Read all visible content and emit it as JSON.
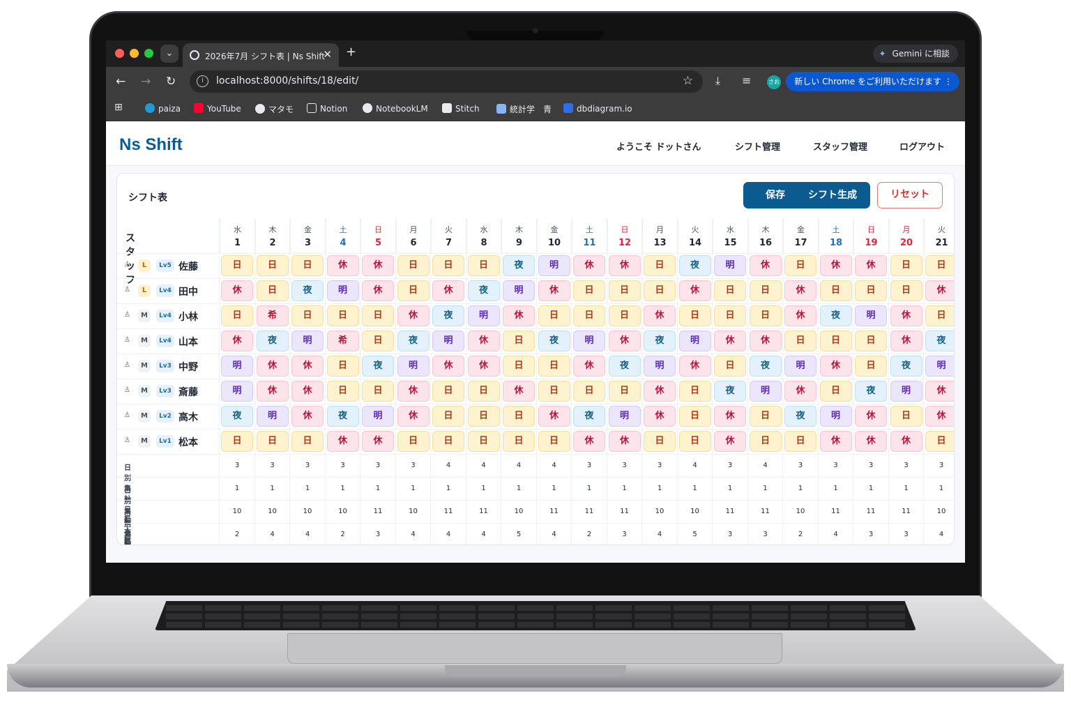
{
  "browser": {
    "tab_title": "2026年7月 シフト表 | Ns Shift",
    "url": "localhost:8000/shifts/18/edit/",
    "gemini_label": "Gemini に相談",
    "update_label": "新しい Chrome をご利用いただけます",
    "profile_initials": "さお",
    "bookmarks": [
      "paiza",
      "YouTube",
      "マタモ",
      "Notion",
      "NotebookLM",
      "Stitch",
      "統計学　青",
      "dbdiagram.io"
    ]
  },
  "app": {
    "logo": "Ns Shift",
    "nav": {
      "welcome": "ようこそ ドットさん",
      "shift_mgmt": "シフト管理",
      "staff_mgmt": "スタッフ管理",
      "logout": "ログアウト"
    }
  },
  "card": {
    "title": "シフト表",
    "buttons": {
      "save": "保存",
      "generate": "シフト生成",
      "reset": "リセット"
    },
    "staff_header": "スタッフ"
  },
  "days": [
    {
      "wd": "水",
      "d": "1",
      "t": ""
    },
    {
      "wd": "木",
      "d": "2",
      "t": ""
    },
    {
      "wd": "金",
      "d": "3",
      "t": ""
    },
    {
      "wd": "土",
      "d": "4",
      "t": "sat"
    },
    {
      "wd": "日",
      "d": "5",
      "t": "sun"
    },
    {
      "wd": "月",
      "d": "6",
      "t": ""
    },
    {
      "wd": "火",
      "d": "7",
      "t": ""
    },
    {
      "wd": "水",
      "d": "8",
      "t": ""
    },
    {
      "wd": "木",
      "d": "9",
      "t": ""
    },
    {
      "wd": "金",
      "d": "10",
      "t": ""
    },
    {
      "wd": "土",
      "d": "11",
      "t": "sat"
    },
    {
      "wd": "日",
      "d": "12",
      "t": "sun"
    },
    {
      "wd": "月",
      "d": "13",
      "t": ""
    },
    {
      "wd": "火",
      "d": "14",
      "t": ""
    },
    {
      "wd": "水",
      "d": "15",
      "t": ""
    },
    {
      "wd": "木",
      "d": "16",
      "t": ""
    },
    {
      "wd": "金",
      "d": "17",
      "t": ""
    },
    {
      "wd": "土",
      "d": "18",
      "t": "sat"
    },
    {
      "wd": "日",
      "d": "19",
      "t": "sun"
    },
    {
      "wd": "月",
      "d": "20",
      "t": "sun"
    },
    {
      "wd": "火",
      "d": "21",
      "t": ""
    }
  ],
  "staff": [
    {
      "role": "♙",
      "lead": "L",
      "lv": "Lv5",
      "name": "佐藤",
      "shifts": [
        "日",
        "日",
        "日",
        "休",
        "休",
        "日",
        "日",
        "日",
        "夜",
        "明",
        "休",
        "休",
        "日",
        "夜",
        "明",
        "休",
        "日",
        "休",
        "休",
        "日",
        "日"
      ]
    },
    {
      "role": "♙",
      "lead": "L",
      "lv": "Lv4",
      "name": "田中",
      "shifts": [
        "休",
        "日",
        "夜",
        "明",
        "休",
        "日",
        "休",
        "夜",
        "明",
        "休",
        "日",
        "日",
        "日",
        "休",
        "日",
        "日",
        "休",
        "日",
        "日",
        "日",
        "休"
      ]
    },
    {
      "role": "♙",
      "lead": "M",
      "lv": "Lv4",
      "name": "小林",
      "shifts": [
        "日",
        "希",
        "日",
        "日",
        "日",
        "休",
        "夜",
        "明",
        "休",
        "日",
        "日",
        "日",
        "休",
        "日",
        "日",
        "日",
        "休",
        "夜",
        "明",
        "休",
        "日"
      ]
    },
    {
      "role": "♙",
      "lead": "M",
      "lv": "Lv4",
      "name": "山本",
      "shifts": [
        "休",
        "夜",
        "明",
        "希",
        "日",
        "夜",
        "明",
        "休",
        "日",
        "夜",
        "明",
        "休",
        "夜",
        "明",
        "休",
        "休",
        "日",
        "日",
        "日",
        "休",
        "夜"
      ]
    },
    {
      "role": "♙",
      "lead": "M",
      "lv": "Lv3",
      "name": "中野",
      "shifts": [
        "明",
        "休",
        "休",
        "日",
        "夜",
        "明",
        "休",
        "休",
        "日",
        "日",
        "休",
        "夜",
        "明",
        "休",
        "日",
        "夜",
        "明",
        "休",
        "日",
        "夜",
        "明"
      ]
    },
    {
      "role": "♙",
      "lead": "M",
      "lv": "Lv3",
      "name": "斎藤",
      "shifts": [
        "明",
        "休",
        "休",
        "日",
        "日",
        "休",
        "日",
        "日",
        "休",
        "日",
        "日",
        "日",
        "休",
        "日",
        "夜",
        "明",
        "休",
        "日",
        "夜",
        "明",
        "休"
      ]
    },
    {
      "role": "♙",
      "lead": "M",
      "lv": "Lv2",
      "name": "高木",
      "shifts": [
        "夜",
        "明",
        "休",
        "夜",
        "明",
        "休",
        "日",
        "日",
        "日",
        "休",
        "夜",
        "明",
        "休",
        "日",
        "休",
        "日",
        "夜",
        "明",
        "休",
        "日",
        "休"
      ]
    },
    {
      "role": "♙",
      "lead": "M",
      "lv": "Lv1",
      "name": "松本",
      "shifts": [
        "日",
        "日",
        "日",
        "休",
        "休",
        "日",
        "日",
        "日",
        "日",
        "日",
        "休",
        "休",
        "日",
        "日",
        "休",
        "日",
        "日",
        "休",
        "休",
        "休",
        "日"
      ]
    }
  ],
  "summary": [
    {
      "label": "日別集計 日勤人数",
      "values": [
        "3",
        "3",
        "3",
        "3",
        "3",
        "3",
        "4",
        "4",
        "4",
        "4",
        "3",
        "3",
        "3",
        "4",
        "3",
        "4",
        "3",
        "3",
        "3",
        "3",
        "3"
      ]
    },
    {
      "label": "日別集計 夜勤人数",
      "values": [
        "1",
        "1",
        "1",
        "1",
        "1",
        "1",
        "1",
        "1",
        "1",
        "1",
        "1",
        "1",
        "1",
        "1",
        "1",
        "1",
        "1",
        "1",
        "1",
        "1",
        "1"
      ]
    },
    {
      "label": "日別集計 日勤能力",
      "values": [
        "10",
        "10",
        "10",
        "10",
        "11",
        "10",
        "11",
        "11",
        "10",
        "11",
        "11",
        "11",
        "10",
        "10",
        "11",
        "11",
        "10",
        "11",
        "11",
        "11",
        "10"
      ]
    },
    {
      "label": "日別集計 夜勤能力",
      "values": [
        "2",
        "4",
        "4",
        "2",
        "3",
        "4",
        "4",
        "4",
        "5",
        "4",
        "2",
        "3",
        "4",
        "5",
        "3",
        "3",
        "2",
        "4",
        "3",
        "3",
        "4"
      ]
    }
  ],
  "colors": {
    "brand": "#0b5b91",
    "reset": "#d93025",
    "saturday": "#1a73b8",
    "sunday": "#e0243b"
  }
}
